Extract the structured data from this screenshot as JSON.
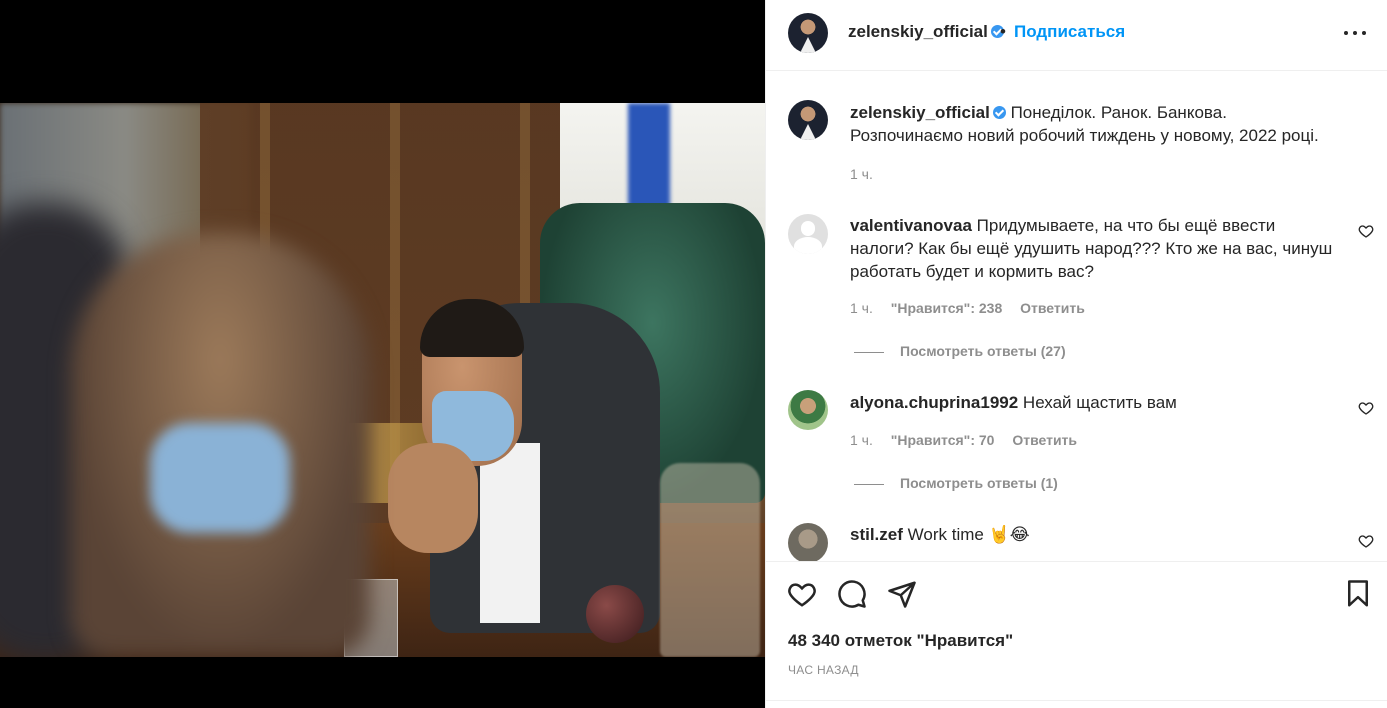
{
  "header": {
    "username": "zelenskiy_official",
    "separator": "•",
    "follow_label": "Подписаться"
  },
  "caption": {
    "username": "zelenskiy_official",
    "text_line1": "Понеділок. Ранок. Банкова.",
    "text_line2": "Розпочинаємо новий робочий тиждень у новому, 2022 році.",
    "time": "1 ч."
  },
  "comments": [
    {
      "username": "valentivanovaa",
      "text_line1": "Придумываете, на что бы ещё ввести",
      "text_line2": "налоги? Как бы ещё удушить народ??? Кто же на вас, чинуш",
      "text_line3": "работать будет и кормить вас?",
      "time": "1 ч.",
      "likes": "\"Нравится\": 238",
      "reply_label": "Ответить",
      "view_replies": "Посмотреть ответы (27)"
    },
    {
      "username": "alyona.chuprina1992",
      "text": "Нехай щастить вам",
      "time": "1 ч.",
      "likes": "\"Нравится\": 70",
      "reply_label": "Ответить",
      "view_replies": "Посмотреть ответы (1)"
    },
    {
      "username": "stil.zef",
      "text": "Work time 🤘😂"
    }
  ],
  "footer": {
    "likes_count": "48 340 отметок \"Нравится\"",
    "time_ago": "ЧАС НАЗАД"
  },
  "icons": {
    "like": "heart-icon",
    "comment": "comment-icon",
    "share": "paper-plane-icon",
    "save": "bookmark-icon",
    "more": "more-dots-icon",
    "verified": "verified-badge-icon"
  },
  "colors": {
    "accent": "#0095f6",
    "verified": "#3897f0",
    "secondary_text": "#8e8e8e",
    "primary_text": "#262626"
  }
}
